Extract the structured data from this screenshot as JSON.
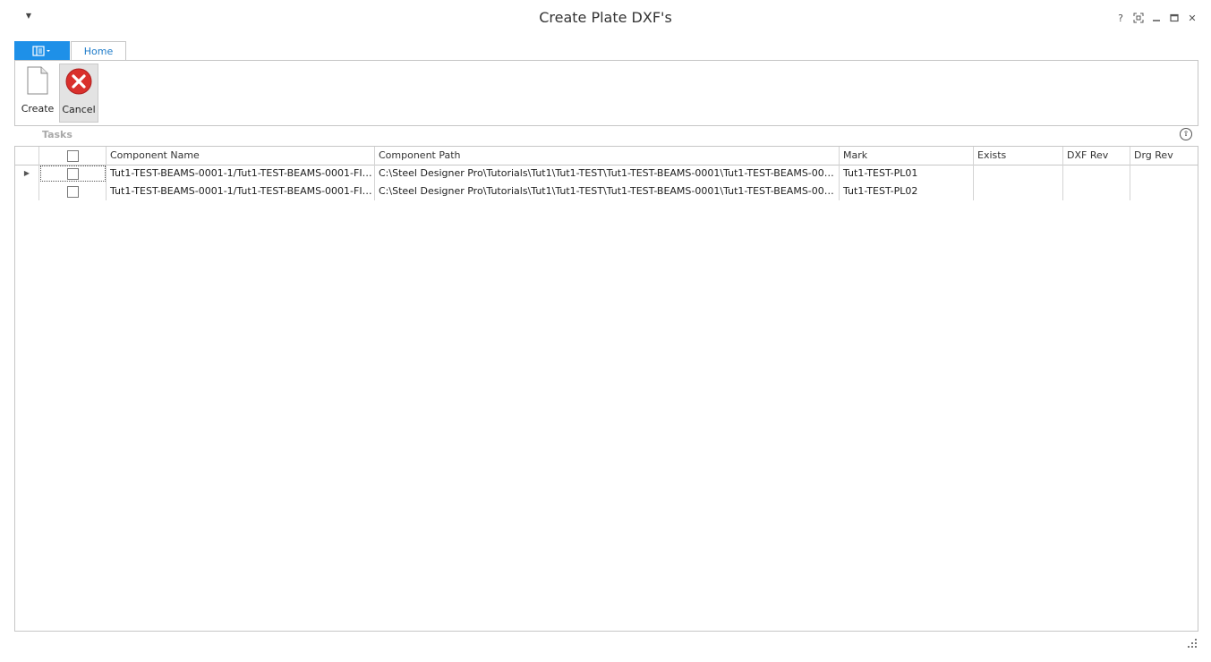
{
  "window": {
    "title": "Create Plate DXF's",
    "qat_icon": "dropdown-arrow-icon",
    "buttons": [
      "help-icon",
      "restore-icon",
      "minimize-icon",
      "maximize-icon",
      "close-icon"
    ],
    "help_glyph": "?",
    "close_glyph": "✕"
  },
  "ribbon": {
    "tabs": [
      {
        "label": "Home"
      }
    ],
    "buttons": {
      "create_label": "Create",
      "cancel_label": "Cancel"
    }
  },
  "tasks": {
    "label": "Tasks"
  },
  "grid": {
    "columns": [
      "Component Name",
      "Component Path",
      "Mark",
      "Exists",
      "DXF Rev",
      "Drg Rev"
    ],
    "rows": [
      {
        "component_name": "Tut1-TEST-BEAMS-0001-1/Tut1-TEST-BEAMS-0001-FIN-C...",
        "component_path": "C:\\Steel Designer Pro\\Tutorials\\Tut1\\Tut1-TEST\\Tut1-TEST-BEAMS-0001\\Tut1-TEST-BEAMS-0001-FIN-...",
        "mark": "Tut1-TEST-PL01",
        "exists": "",
        "dxf_rev": "",
        "drg_rev": ""
      },
      {
        "component_name": "Tut1-TEST-BEAMS-0001-1/Tut1-TEST-BEAMS-0001-FIN-C...",
        "component_path": "C:\\Steel Designer Pro\\Tutorials\\Tut1\\Tut1-TEST\\Tut1-TEST-BEAMS-0001\\Tut1-TEST-BEAMS-0001-FIN-...",
        "mark": "Tut1-TEST-PL02",
        "exists": "",
        "dxf_rev": "",
        "drg_rev": ""
      }
    ]
  },
  "colors": {
    "accent": "#1e90e8",
    "tab_text": "#1d7bc9",
    "cancel_icon": "#d9302c"
  }
}
